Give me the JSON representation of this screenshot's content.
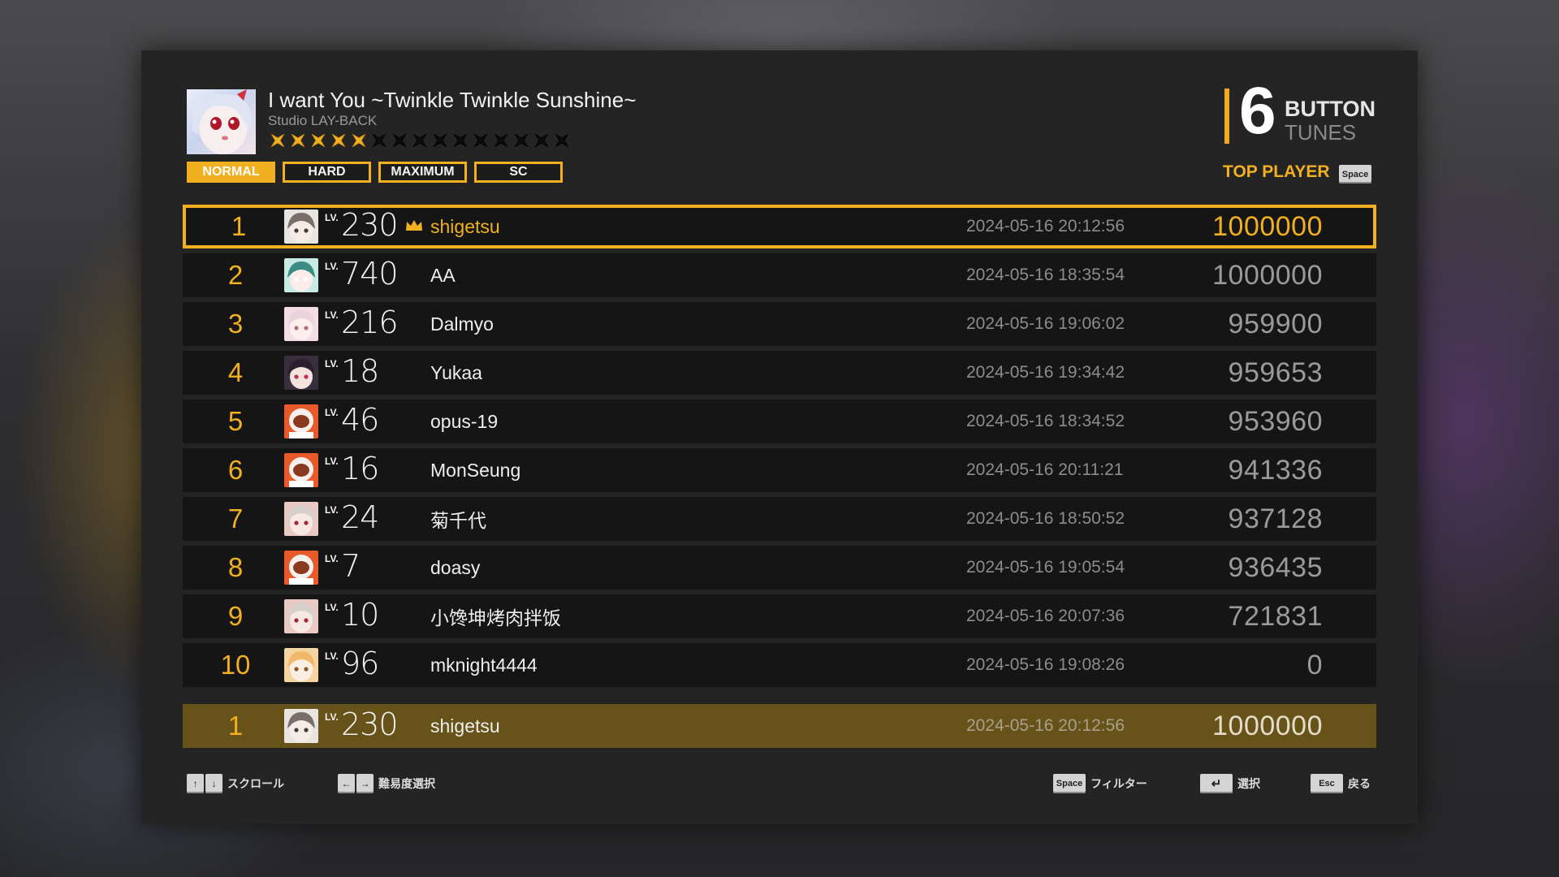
{
  "song": {
    "title": "I want You ~Twinkle Twinkle Sunshine~",
    "artist": "Studio LAY-BACK",
    "difficulty_stars": 5,
    "max_stars": 15
  },
  "difficulty_tabs": [
    {
      "label": "NORMAL",
      "active": true
    },
    {
      "label": "HARD",
      "active": false
    },
    {
      "label": "MAXIMUM",
      "active": false
    },
    {
      "label": "SC",
      "active": false
    }
  ],
  "mode_logo": {
    "number": "6",
    "word1": "BUTTON",
    "word2": "TUNES"
  },
  "top_player": {
    "label": "TOP PLAYER",
    "key": "Space"
  },
  "leaderboard": [
    {
      "rank": "1",
      "lv_label": "LV.",
      "level": "230",
      "name": "shigetsu",
      "datetime": "2024-05-16 20:12:56",
      "score": "1000000",
      "crown": true,
      "avatar": "grey"
    },
    {
      "rank": "2",
      "lv_label": "LV.",
      "level": "740",
      "name": "AA",
      "datetime": "2024-05-16 18:35:54",
      "score": "1000000",
      "crown": false,
      "avatar": "teal"
    },
    {
      "rank": "3",
      "lv_label": "LV.",
      "level": "216",
      "name": "Dalmyo",
      "datetime": "2024-05-16 19:06:02",
      "score": "959900",
      "crown": false,
      "avatar": "pink"
    },
    {
      "rank": "4",
      "lv_label": "LV.",
      "level": "18",
      "name": "Yukaa",
      "datetime": "2024-05-16 19:34:42",
      "score": "959653",
      "crown": false,
      "avatar": "dark"
    },
    {
      "rank": "5",
      "lv_label": "LV.",
      "level": "46",
      "name": "opus-19",
      "datetime": "2024-05-16 18:34:52",
      "score": "953960",
      "crown": false,
      "avatar": "orange"
    },
    {
      "rank": "6",
      "lv_label": "LV.",
      "level": "16",
      "name": "MonSeung",
      "datetime": "2024-05-16 20:11:21",
      "score": "941336",
      "crown": false,
      "avatar": "orange"
    },
    {
      "rank": "7",
      "lv_label": "LV.",
      "level": "24",
      "name": "菊千代",
      "datetime": "2024-05-16 18:50:52",
      "score": "937128",
      "crown": false,
      "avatar": "rose"
    },
    {
      "rank": "8",
      "lv_label": "LV.",
      "level": "7",
      "name": "doasy",
      "datetime": "2024-05-16 19:05:54",
      "score": "936435",
      "crown": false,
      "avatar": "orange"
    },
    {
      "rank": "9",
      "lv_label": "LV.",
      "level": "10",
      "name": "小馋坤烤肉拌饭",
      "datetime": "2024-05-16 20:07:36",
      "score": "721831",
      "crown": false,
      "avatar": "rose"
    },
    {
      "rank": "10",
      "lv_label": "LV.",
      "level": "96",
      "name": "mknight4444",
      "datetime": "2024-05-16 19:08:26",
      "score": "0",
      "crown": false,
      "avatar": "blonde"
    }
  ],
  "my_record": {
    "rank": "1",
    "lv_label": "LV.",
    "level": "230",
    "name": "shigetsu",
    "datetime": "2024-05-16 20:12:56",
    "score": "1000000",
    "avatar": "grey"
  },
  "footer": {
    "scroll": {
      "keys": [
        "↑",
        "↓"
      ],
      "label": "スクロール"
    },
    "difficulty_select": {
      "keys": [
        "←",
        "→"
      ],
      "label": "難易度選択"
    },
    "filter": {
      "key": "Space",
      "label": "フィルター"
    },
    "select": {
      "key": "↵",
      "label": "選択"
    },
    "back": {
      "key": "Esc",
      "label": "戻る"
    }
  },
  "colors": {
    "accent": "#f0b020",
    "row_bg": "#151515",
    "mine_bg": "#675319",
    "panel_bg": "#242424"
  }
}
